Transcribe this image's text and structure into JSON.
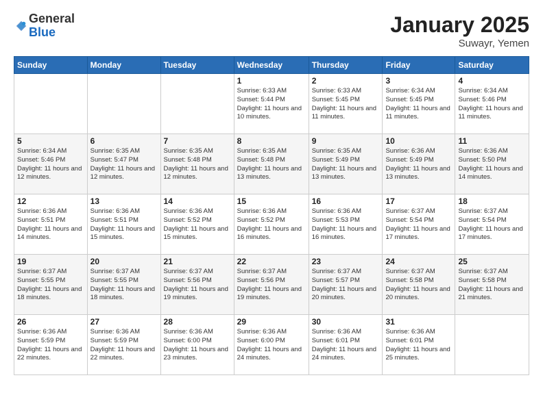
{
  "logo": {
    "general": "General",
    "blue": "Blue"
  },
  "header": {
    "month": "January 2025",
    "location": "Suwayr, Yemen"
  },
  "weekdays": [
    "Sunday",
    "Monday",
    "Tuesday",
    "Wednesday",
    "Thursday",
    "Friday",
    "Saturday"
  ],
  "weeks": [
    [
      {
        "day": null,
        "info": null
      },
      {
        "day": null,
        "info": null
      },
      {
        "day": null,
        "info": null
      },
      {
        "day": "1",
        "info": "Sunrise: 6:33 AM\nSunset: 5:44 PM\nDaylight: 11 hours\nand 10 minutes."
      },
      {
        "day": "2",
        "info": "Sunrise: 6:33 AM\nSunset: 5:45 PM\nDaylight: 11 hours\nand 11 minutes."
      },
      {
        "day": "3",
        "info": "Sunrise: 6:34 AM\nSunset: 5:45 PM\nDaylight: 11 hours\nand 11 minutes."
      },
      {
        "day": "4",
        "info": "Sunrise: 6:34 AM\nSunset: 5:46 PM\nDaylight: 11 hours\nand 11 minutes."
      }
    ],
    [
      {
        "day": "5",
        "info": "Sunrise: 6:34 AM\nSunset: 5:46 PM\nDaylight: 11 hours\nand 12 minutes."
      },
      {
        "day": "6",
        "info": "Sunrise: 6:35 AM\nSunset: 5:47 PM\nDaylight: 11 hours\nand 12 minutes."
      },
      {
        "day": "7",
        "info": "Sunrise: 6:35 AM\nSunset: 5:48 PM\nDaylight: 11 hours\nand 12 minutes."
      },
      {
        "day": "8",
        "info": "Sunrise: 6:35 AM\nSunset: 5:48 PM\nDaylight: 11 hours\nand 13 minutes."
      },
      {
        "day": "9",
        "info": "Sunrise: 6:35 AM\nSunset: 5:49 PM\nDaylight: 11 hours\nand 13 minutes."
      },
      {
        "day": "10",
        "info": "Sunrise: 6:36 AM\nSunset: 5:49 PM\nDaylight: 11 hours\nand 13 minutes."
      },
      {
        "day": "11",
        "info": "Sunrise: 6:36 AM\nSunset: 5:50 PM\nDaylight: 11 hours\nand 14 minutes."
      }
    ],
    [
      {
        "day": "12",
        "info": "Sunrise: 6:36 AM\nSunset: 5:51 PM\nDaylight: 11 hours\nand 14 minutes."
      },
      {
        "day": "13",
        "info": "Sunrise: 6:36 AM\nSunset: 5:51 PM\nDaylight: 11 hours\nand 15 minutes."
      },
      {
        "day": "14",
        "info": "Sunrise: 6:36 AM\nSunset: 5:52 PM\nDaylight: 11 hours\nand 15 minutes."
      },
      {
        "day": "15",
        "info": "Sunrise: 6:36 AM\nSunset: 5:52 PM\nDaylight: 11 hours\nand 16 minutes."
      },
      {
        "day": "16",
        "info": "Sunrise: 6:36 AM\nSunset: 5:53 PM\nDaylight: 11 hours\nand 16 minutes."
      },
      {
        "day": "17",
        "info": "Sunrise: 6:37 AM\nSunset: 5:54 PM\nDaylight: 11 hours\nand 17 minutes."
      },
      {
        "day": "18",
        "info": "Sunrise: 6:37 AM\nSunset: 5:54 PM\nDaylight: 11 hours\nand 17 minutes."
      }
    ],
    [
      {
        "day": "19",
        "info": "Sunrise: 6:37 AM\nSunset: 5:55 PM\nDaylight: 11 hours\nand 18 minutes."
      },
      {
        "day": "20",
        "info": "Sunrise: 6:37 AM\nSunset: 5:55 PM\nDaylight: 11 hours\nand 18 minutes."
      },
      {
        "day": "21",
        "info": "Sunrise: 6:37 AM\nSunset: 5:56 PM\nDaylight: 11 hours\nand 19 minutes."
      },
      {
        "day": "22",
        "info": "Sunrise: 6:37 AM\nSunset: 5:56 PM\nDaylight: 11 hours\nand 19 minutes."
      },
      {
        "day": "23",
        "info": "Sunrise: 6:37 AM\nSunset: 5:57 PM\nDaylight: 11 hours\nand 20 minutes."
      },
      {
        "day": "24",
        "info": "Sunrise: 6:37 AM\nSunset: 5:58 PM\nDaylight: 11 hours\nand 20 minutes."
      },
      {
        "day": "25",
        "info": "Sunrise: 6:37 AM\nSunset: 5:58 PM\nDaylight: 11 hours\nand 21 minutes."
      }
    ],
    [
      {
        "day": "26",
        "info": "Sunrise: 6:36 AM\nSunset: 5:59 PM\nDaylight: 11 hours\nand 22 minutes."
      },
      {
        "day": "27",
        "info": "Sunrise: 6:36 AM\nSunset: 5:59 PM\nDaylight: 11 hours\nand 22 minutes."
      },
      {
        "day": "28",
        "info": "Sunrise: 6:36 AM\nSunset: 6:00 PM\nDaylight: 11 hours\nand 23 minutes."
      },
      {
        "day": "29",
        "info": "Sunrise: 6:36 AM\nSunset: 6:00 PM\nDaylight: 11 hours\nand 24 minutes."
      },
      {
        "day": "30",
        "info": "Sunrise: 6:36 AM\nSunset: 6:01 PM\nDaylight: 11 hours\nand 24 minutes."
      },
      {
        "day": "31",
        "info": "Sunrise: 6:36 AM\nSunset: 6:01 PM\nDaylight: 11 hours\nand 25 minutes."
      },
      {
        "day": null,
        "info": null
      }
    ]
  ]
}
